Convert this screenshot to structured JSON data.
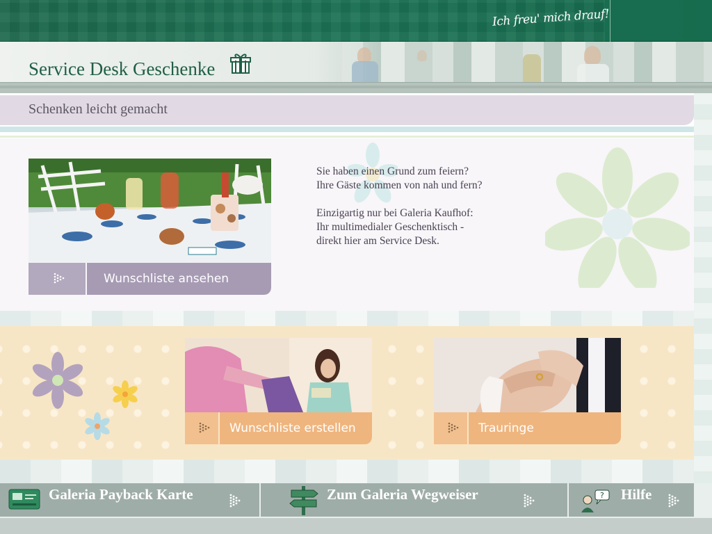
{
  "header": {
    "slogan": "Ich freu' mich drauf!",
    "title": "Service Desk Geschenke",
    "subtitle": "Schenken leicht gemacht"
  },
  "intro": {
    "paragraph1_line1": "Sie haben einen Grund zum feiern?",
    "paragraph1_line2": "Ihre Gäste kommen von nah und fern?",
    "paragraph2_line1": "Einzigartig nur bei Galeria Kaufhof:",
    "paragraph2_line2": "Ihr multimedialer Geschenktisch -",
    "paragraph2_line3": "direkt hier am Service Desk."
  },
  "cards": {
    "view_wishlist": "Wunschliste ansehen",
    "create_wishlist": "Wunschliste erstellen",
    "wedding_rings": "Trauringe"
  },
  "bottom_nav": {
    "payback": "Galeria Payback Karte",
    "directory": "Zum Galeria Wegweiser",
    "help": "Hilfe"
  },
  "icons": {
    "gift": "gift-icon",
    "card": "card-icon",
    "signpost": "signpost-icon",
    "help": "help-person-icon",
    "arrow_dots": "dotted-arrow-icon"
  },
  "colors": {
    "brand_green": "#1c7356",
    "violet_button": "#a79bb4",
    "orange_button": "#efb57e",
    "nav_gray": "#9fada8"
  }
}
